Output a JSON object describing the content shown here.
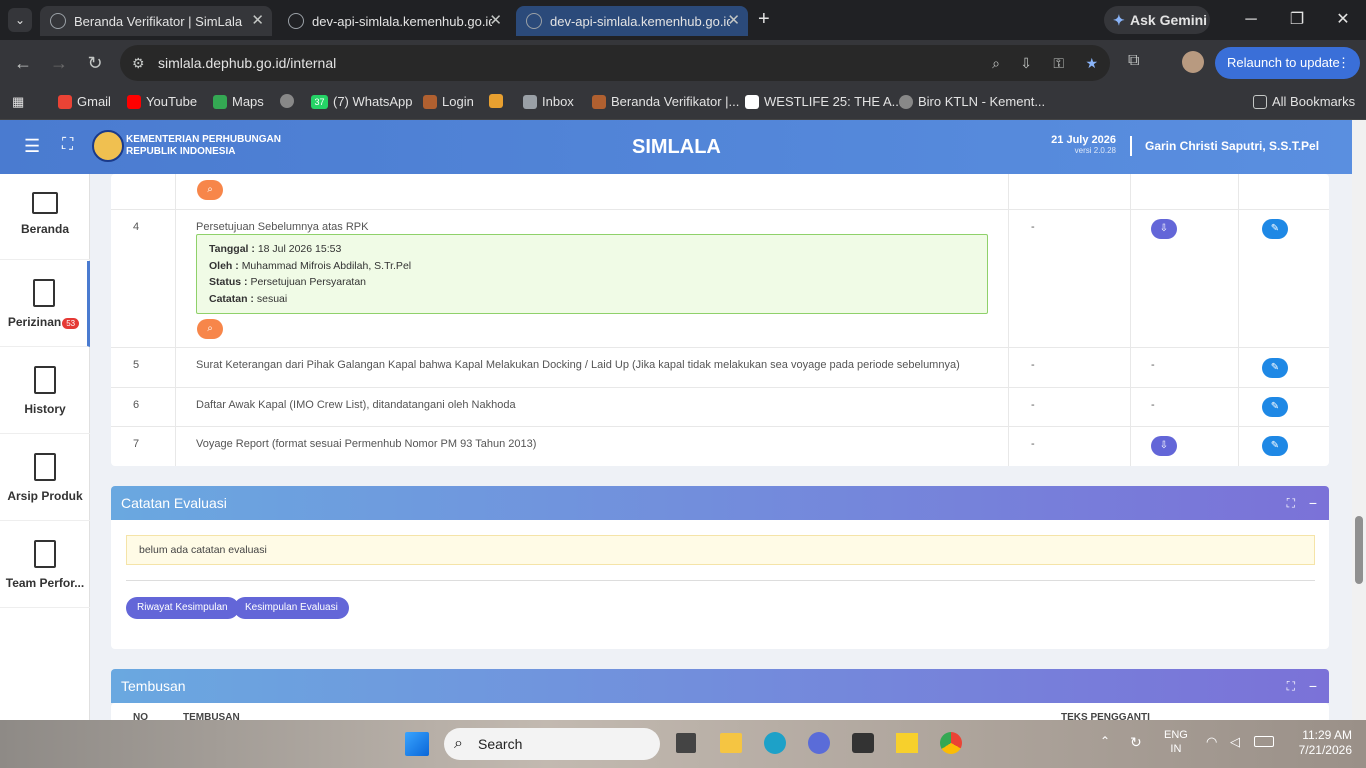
{
  "tabs": [
    {
      "title": "Beranda Verifikator | SimLala"
    },
    {
      "title": "dev-api-simlala.kemenhub.go.id"
    },
    {
      "title": "dev-api-simlala.kemenhub.go.id"
    }
  ],
  "browser": {
    "ask_gemini": "Ask Gemini",
    "url": "simlala.dephub.go.id/internal",
    "relaunch": "Relaunch to update"
  },
  "bookmarks": [
    "Gmail",
    "YouTube",
    "Maps",
    "(7) WhatsApp",
    "Login",
    "Inbox",
    "Beranda Verifikator |...",
    "WESTLIFE 25: THE A...",
    "Biro KTLN - Kement..."
  ],
  "whatsapp_count": "37",
  "all_bookmarks": "All Bookmarks",
  "header": {
    "ministry_line1": "KEMENTERIAN PERHUBUNGAN",
    "ministry_line2": "REPUBLIK INDONESIA",
    "app_title": "SIMLALA",
    "date": "21 July 2026",
    "version": "versi 2.0.28",
    "user": "Garin Christi Saputri, S.S.T.Pel"
  },
  "sidebar": [
    {
      "label": "Beranda"
    },
    {
      "label": "Perizinan",
      "badge": "53"
    },
    {
      "label": "History"
    },
    {
      "label": "Arsip Produk"
    },
    {
      "label": "Team Perfor..."
    }
  ],
  "rows": [
    {
      "no": "4",
      "desc": "Persetujuan Sebelumnya atas RPK",
      "d1": "-",
      "approval": {
        "tanggal_label": "Tanggal :",
        "tanggal": "18 Jul 2026 15:53",
        "oleh_label": "Oleh :",
        "oleh": "Muhammad Mifrois Abdilah, S.Tr.Pel",
        "status_label": "Status :",
        "status": "Persetujuan Persyaratan",
        "catatan_label": "Catatan :",
        "catatan": "sesuai"
      }
    },
    {
      "no": "5",
      "desc": "Surat Keterangan dari Pihak Galangan Kapal bahwa Kapal Melakukan Docking / Laid Up (Jika kapal tidak melakukan sea voyage pada periode sebelumnya)",
      "d1": "-",
      "d2": "-"
    },
    {
      "no": "6",
      "desc": "Daftar Awak Kapal (IMO Crew List), ditandatangani oleh Nakhoda",
      "d1": "-",
      "d2": "-"
    },
    {
      "no": "7",
      "desc": "Voyage Report (format sesuai Permenhub Nomor PM 93 Tahun 2013)",
      "d1": "-"
    }
  ],
  "catatan_evaluasi": {
    "title": "Catatan Evaluasi",
    "empty": "belum ada catatan evaluasi",
    "btn_riwayat": "Riwayat Kesimpulan",
    "btn_kesimpulan": "Kesimpulan Evaluasi"
  },
  "tembusan": {
    "title": "Tembusan",
    "col_no": "NO",
    "col_tembusan": "TEMBUSAN",
    "col_teks": "TEKS PENGGANTI"
  },
  "taskbar": {
    "search": "Search",
    "lang1": "ENG",
    "lang2": "IN",
    "time": "11:29 AM",
    "date": "7/21/2026"
  }
}
